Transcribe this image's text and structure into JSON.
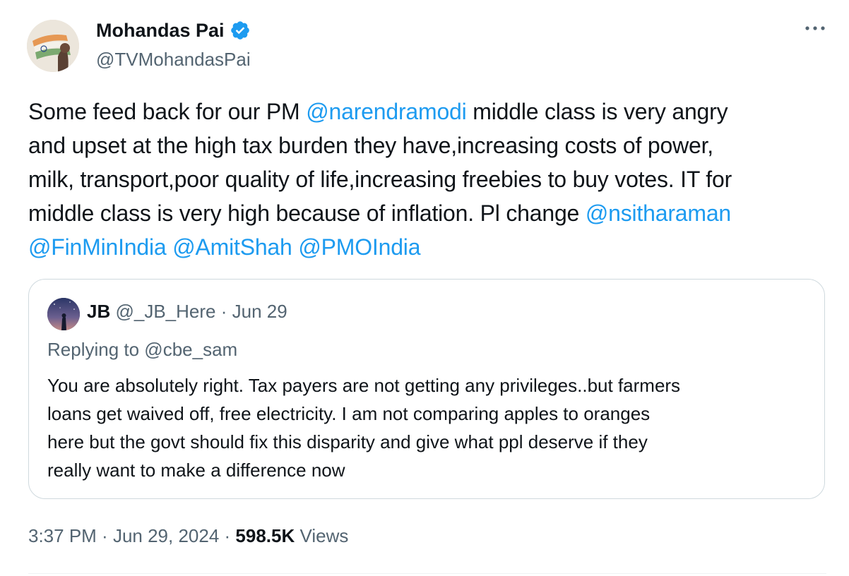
{
  "author": {
    "name": "Mohandas Pai",
    "handle": "@TVMohandasPai",
    "verified_color": "#1d9bf0"
  },
  "more_icon": "more-horizontal-icon",
  "tweet": {
    "lines": [
      [
        {
          "t": "Some feed back for our PM ",
          "m": false
        },
        {
          "t": "@narendramodi",
          "m": true
        },
        {
          "t": " middle  class is very angry",
          "m": false
        }
      ],
      [
        {
          "t": "and upset at the high tax burden they have,increasing costs of power,",
          "m": false
        }
      ],
      [
        {
          "t": "milk, transport,poor quality of life,increasing freebies to buy votes. IT for",
          "m": false
        }
      ],
      [
        {
          "t": "middle class is very high because of inflation. Pl change ",
          "m": false
        },
        {
          "t": "@nsitharaman",
          "m": true
        }
      ],
      [
        {
          "t": "@FinMinIndia",
          "m": true
        },
        {
          "t": " ",
          "m": false
        },
        {
          "t": "@AmitShah",
          "m": true
        },
        {
          "t": " ",
          "m": false
        },
        {
          "t": "@PMOIndia",
          "m": true
        }
      ]
    ]
  },
  "quote": {
    "name": "JB",
    "handle": "@_JB_Here",
    "date": "Jun 29",
    "replying_to": "Replying to @cbe_sam",
    "lines": [
      "You are absolutely right. Tax payers are not getting any privileges..but farmers",
      "loans get waived off, free electricity. I am not comparing apples to oranges",
      "here but the govt should fix this disparity and give what ppl deserve if they",
      "really want to make a difference now"
    ]
  },
  "footer": {
    "time": "3:37 PM",
    "date": "Jun 29, 2024",
    "views_count": "598.5K",
    "views_label": "Views"
  },
  "colors": {
    "mention": "#1d9bf0",
    "secondary": "#536471",
    "border": "#cfd9de"
  }
}
